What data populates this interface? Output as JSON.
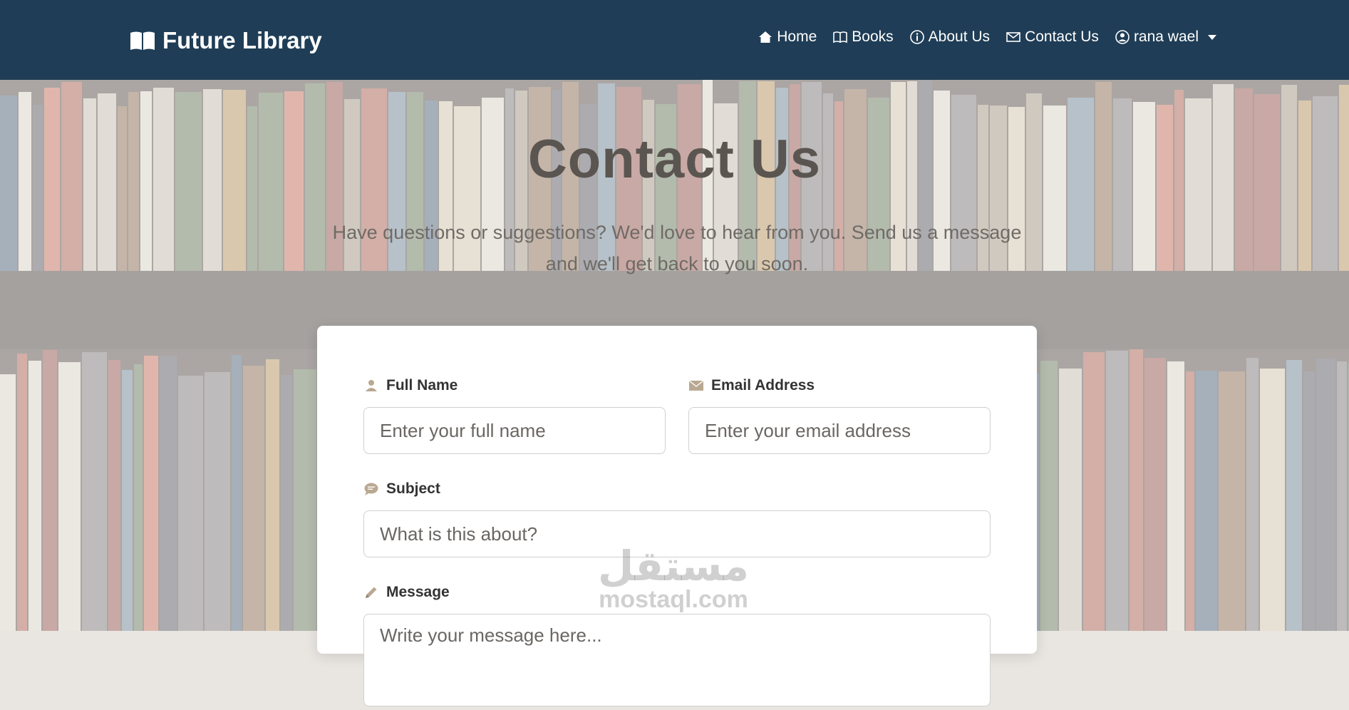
{
  "navbar": {
    "brand": "Future Library",
    "links": [
      {
        "label": "Home",
        "icon": "home-icon"
      },
      {
        "label": "Books",
        "icon": "book-icon"
      },
      {
        "label": "About Us",
        "icon": "info-icon"
      },
      {
        "label": "Contact Us",
        "icon": "envelope-icon"
      }
    ],
    "user": {
      "label": "rana wael",
      "icon": "user-circle-icon"
    }
  },
  "hero": {
    "title": "Contact Us",
    "subtitle": "Have questions or suggestions? We'd love to hear from you. Send us a message and we'll get back to you soon."
  },
  "form": {
    "full_name": {
      "label": "Full Name",
      "placeholder": "Enter your full name",
      "icon": "person-icon"
    },
    "email": {
      "label": "Email Address",
      "placeholder": "Enter your email address",
      "icon": "envelope-icon"
    },
    "subject": {
      "label": "Subject",
      "placeholder": "What is this about?",
      "icon": "chat-bubble-icon"
    },
    "message": {
      "label": "Message",
      "placeholder": "Write your message here...",
      "icon": "pencil-icon"
    }
  },
  "watermark": {
    "arabic": "مستقل",
    "latin": "mostaql.com"
  },
  "colors": {
    "navbar": "#1f3d56",
    "accent_icon": "#b9a892",
    "title": "#5a5550"
  }
}
